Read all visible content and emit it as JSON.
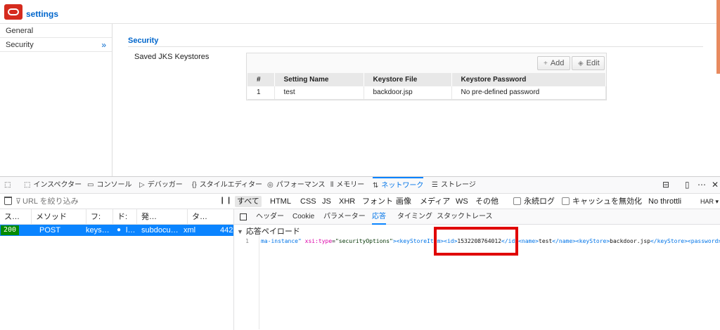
{
  "app": {
    "title": "settings",
    "sidebar": [
      {
        "label": "General"
      },
      {
        "label": "Security",
        "chevron": "»"
      }
    ],
    "section_title": "Security",
    "keystores_label": "Saved JKS Keystores",
    "buttons": {
      "add": "Add",
      "edit": "Edit"
    },
    "table": {
      "headers": [
        "#",
        "Setting Name",
        "Keystore File",
        "Keystore Password"
      ],
      "rows": [
        [
          "1",
          "test",
          "backdoor.jsp",
          "No pre-defined password"
        ]
      ]
    }
  },
  "devtools": {
    "tabs": [
      {
        "icon": "⬚",
        "label": "インスペクター"
      },
      {
        "icon": "▭",
        "label": "コンソール"
      },
      {
        "icon": "▷",
        "label": "デバッガー"
      },
      {
        "icon": "{}",
        "label": "スタイルエディター"
      },
      {
        "icon": "◎",
        "label": "パフォーマンス"
      },
      {
        "icon": "⫴",
        "label": "メモリー"
      },
      {
        "icon": "⇅",
        "label": "ネットワーク",
        "active": true
      },
      {
        "icon": "☰",
        "label": "ストレージ"
      }
    ],
    "right_icons": [
      "⊟",
      "⋯",
      "✕"
    ],
    "filter": {
      "placeholder": "URL を絞り込み",
      "types": [
        "すべて",
        "HTML",
        "CSS",
        "JS",
        "XHR",
        "フォント",
        "画像",
        "メディア",
        "WS",
        "その他"
      ],
      "persist_log": "永続ログ",
      "disable_cache": "キャッシュを無効化",
      "throttling": "No throttli",
      "har": "HAR ▾"
    },
    "request_columns": [
      "ス…",
      "メソッド",
      "フ:",
      "ド:",
      "発…",
      "タ…"
    ],
    "request_row": {
      "status": "200",
      "method": "POST",
      "file": "keys…",
      "domain": "l…",
      "cause": "subdocu…",
      "type": "xml",
      "size": "442"
    },
    "detail_tabs": [
      "ヘッダー",
      "Cookie",
      "パラメーター",
      "応答",
      "タイミング",
      "スタックトレース"
    ],
    "active_detail_tab": "応答",
    "payload_title": "応答ペイロード",
    "line_number": "1",
    "code_segments": [
      {
        "cls": "ct",
        "text": "ma-instance\" "
      },
      {
        "cls": "ca",
        "text": "xsi:type"
      },
      {
        "cls": "cx",
        "text": "="
      },
      {
        "cls": "cv",
        "text": "\"securityOptions\""
      },
      {
        "cls": "ct",
        "text": "><keyStoreItem><id>"
      },
      {
        "cls": "cx",
        "text": "1532208764012"
      },
      {
        "cls": "ct",
        "text": "</id><name>"
      },
      {
        "cls": "cx",
        "text": "test"
      },
      {
        "cls": "ct",
        "text": "</name><keyStore>"
      },
      {
        "cls": "cx",
        "text": "backdoor.jsp"
      },
      {
        "cls": "ct",
        "text": "</keyStore><password></"
      }
    ]
  }
}
